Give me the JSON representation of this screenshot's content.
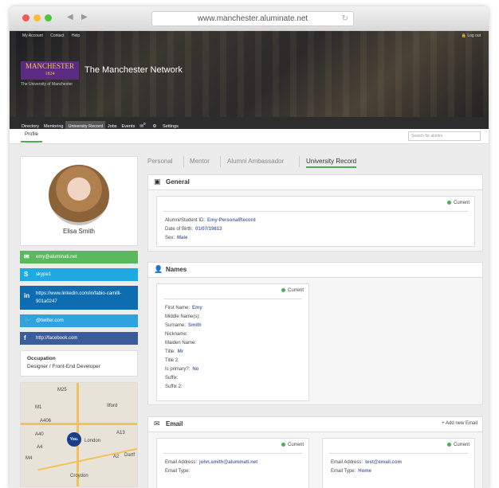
{
  "browser": {
    "url": "www.manchester.aluminate.net"
  },
  "topbar": {
    "my_account": "My Account",
    "contact": "Contact",
    "help": "Help",
    "logout": "Log out"
  },
  "brand": {
    "logo_text": "MANCHESTER",
    "logo_year": "1824",
    "university": "The University of Manchester",
    "site_title": "The Manchester Network"
  },
  "nav": {
    "items": [
      "Directory",
      "Mentoring",
      "University Record",
      "Jobs",
      "Events"
    ],
    "settings": "Settings",
    "notification_count": "0"
  },
  "subnav": {
    "profile": "Profile",
    "search_placeholder": "Search for alumni"
  },
  "profile": {
    "name": "Elisa Smith",
    "contacts": {
      "email": "emy@aluminati.net",
      "skype": "skype1",
      "linkedin": "https://www.linkedin.com/in/fabio-camilli-901a0247",
      "twitter": "@twitter.com",
      "facebook": "http://facebook.com"
    },
    "occupation_title": "Occupation",
    "occupation": "Designer / Front-End Developer"
  },
  "map": {
    "labels": [
      "Ilford",
      "London",
      "Dartf",
      "Croydon",
      "M25",
      "M1",
      "A406",
      "A40",
      "A4",
      "M4",
      "A2",
      "A13",
      "You."
    ]
  },
  "tabs": [
    "Personal",
    "Mentor",
    "Alumni Ambassador",
    "University Record"
  ],
  "general": {
    "title": "General",
    "status": "Current",
    "rows": [
      {
        "label": "Alumni/Student ID:",
        "value": "Emy-PersonalRecord"
      },
      {
        "label": "Date of Birth:",
        "value": "01/07/19813"
      },
      {
        "label": "Sex:",
        "value": "Male"
      }
    ]
  },
  "names": {
    "title": "Names",
    "status": "Current",
    "rows": [
      {
        "label": "First Name:",
        "value": "Emy"
      },
      {
        "label": "Middle Name(s):",
        "value": ""
      },
      {
        "label": "Surname:",
        "value": "Smith"
      },
      {
        "label": "Nickname:",
        "value": ""
      },
      {
        "label": "Maiden Name:",
        "value": ""
      },
      {
        "label": "Title:",
        "value": "Mr"
      },
      {
        "label": "Title 2:",
        "value": ""
      },
      {
        "label": "Is primary?:",
        "value": "No"
      },
      {
        "label": "Suffix:",
        "value": ""
      },
      {
        "label": "Suffix 2:",
        "value": ""
      }
    ]
  },
  "email": {
    "title": "Email",
    "add_new": "+ Add new Email",
    "cards": [
      {
        "status": "Current",
        "address_label": "Email Address:",
        "address": "john.smith@aluminati.net",
        "type_label": "Email Type:",
        "type": ""
      },
      {
        "status": "Current",
        "address_label": "Email Address:",
        "address": "test@email.com",
        "type_label": "Email Type:",
        "type": "Home"
      }
    ]
  }
}
